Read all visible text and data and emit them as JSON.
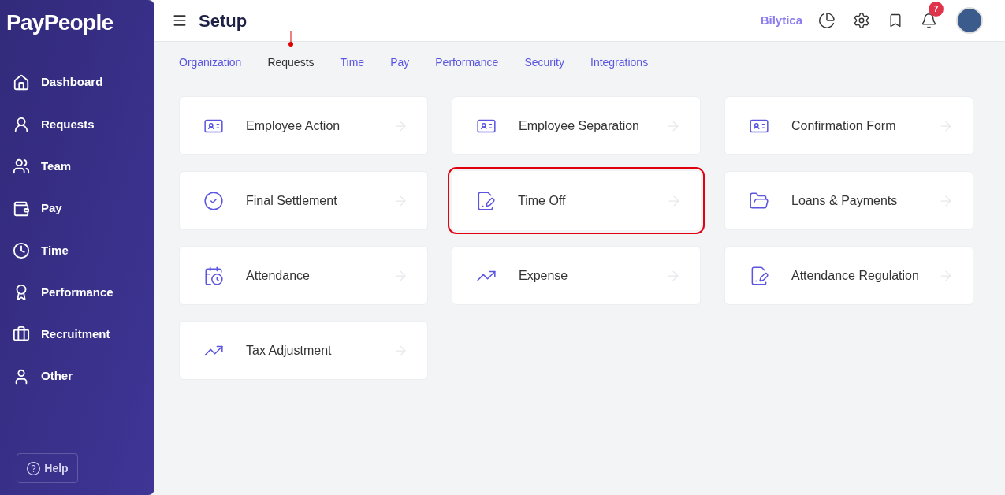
{
  "logo": "PayPeople",
  "sidebar": {
    "items": [
      {
        "label": "Dashboard",
        "kind": "home",
        "selected": false
      },
      {
        "label": "Requests",
        "kind": "request",
        "selected": false
      },
      {
        "label": "Team",
        "kind": "team",
        "selected": false
      },
      {
        "label": "Pay",
        "kind": "wallet",
        "selected": false
      },
      {
        "label": "Time",
        "kind": "clock",
        "selected": false
      },
      {
        "label": "Performance",
        "kind": "award",
        "selected": false
      },
      {
        "label": "Recruitment",
        "kind": "briefcase",
        "selected": false
      },
      {
        "label": "Other",
        "kind": "user",
        "selected": false
      }
    ],
    "help": "Help"
  },
  "header": {
    "title": "Setup",
    "company": "Bilytica",
    "notifications": "7"
  },
  "tabs": [
    {
      "label": "Organization",
      "selected": false
    },
    {
      "label": "Requests",
      "selected": true
    },
    {
      "label": "Time",
      "selected": false
    },
    {
      "label": "Pay",
      "selected": false
    },
    {
      "label": "Performance",
      "selected": false
    },
    {
      "label": "Security",
      "selected": false
    },
    {
      "label": "Integrations",
      "selected": false
    }
  ],
  "cards": [
    {
      "label": "Employee Action",
      "kind": "idcard",
      "highlighted": false
    },
    {
      "label": "Employee Separation",
      "kind": "idcard",
      "highlighted": false
    },
    {
      "label": "Confirmation Form",
      "kind": "idcard",
      "highlighted": false
    },
    {
      "label": "Final Settlement",
      "kind": "check",
      "highlighted": false
    },
    {
      "label": "Time Off",
      "kind": "doc",
      "highlighted": true
    },
    {
      "label": "Loans & Payments",
      "kind": "folder",
      "highlighted": false
    },
    {
      "label": "Attendance",
      "kind": "calendar",
      "highlighted": false
    },
    {
      "label": "Expense",
      "kind": "trend",
      "highlighted": false
    },
    {
      "label": "Attendance Regulation",
      "kind": "doc",
      "highlighted": false
    },
    {
      "label": "Tax Adjustment",
      "kind": "trend",
      "highlighted": false
    }
  ]
}
